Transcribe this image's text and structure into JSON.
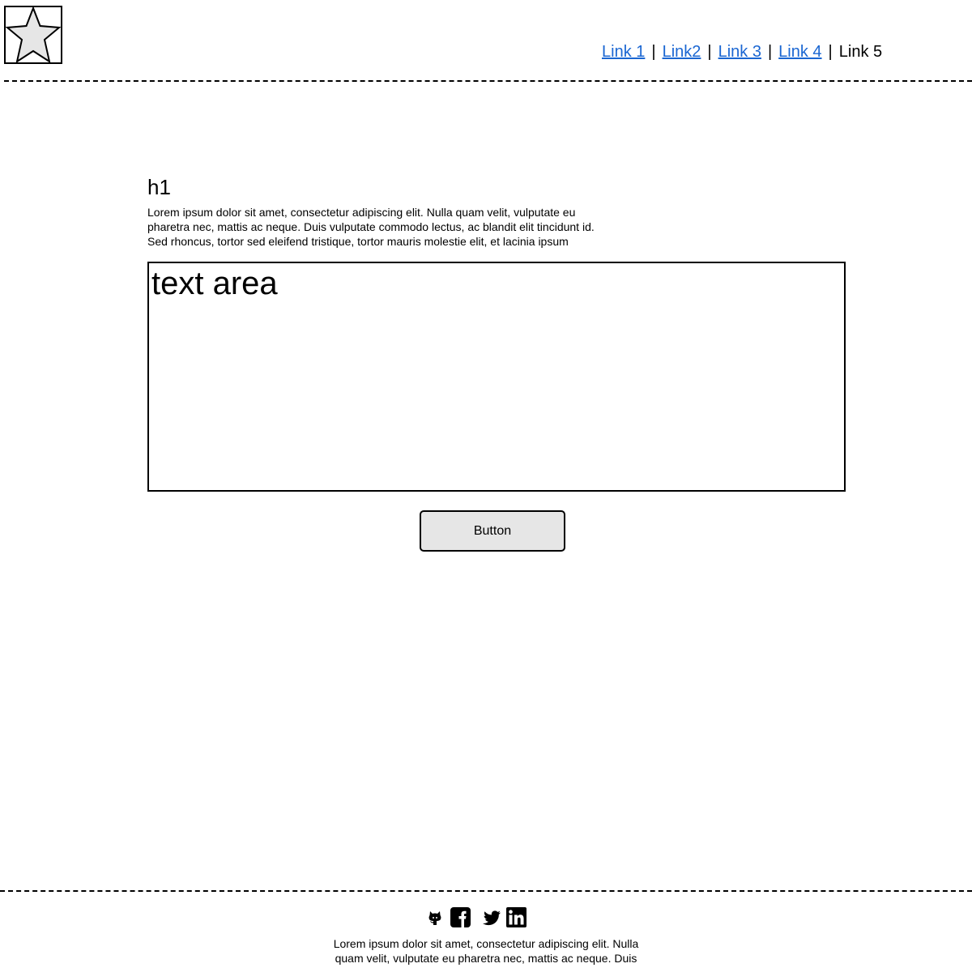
{
  "header": {
    "logo_icon": "star-icon",
    "nav": {
      "links": [
        {
          "label": "Link 1",
          "active": false
        },
        {
          "label": "Link2",
          "active": false
        },
        {
          "label": "Link 3",
          "active": false
        },
        {
          "label": "Link 4",
          "active": false
        },
        {
          "label": "Link 5",
          "active": true
        }
      ],
      "separator": "|",
      "link_color": "#1a66d2"
    }
  },
  "main": {
    "heading": "h1",
    "intro": "Lorem ipsum dolor sit amet, consectetur adipiscing elit. Nulla quam velit, vulputate eu pharetra nec, mattis ac neque. Duis vulputate commodo lectus, ac blandit elit tincidunt id. Sed rhoncus, tortor sed eleifend tristique, tortor mauris molestie elit, et lacinia ipsum",
    "textarea_value": "text area",
    "button_label": "Button",
    "button_color": "#e6e6e6"
  },
  "footer": {
    "social_icons": [
      "github-icon",
      "facebook-icon",
      "twitter-icon",
      "linkedin-icon"
    ],
    "text": "Lorem ipsum dolor sit amet, consectetur adipiscing elit. Nulla quam velit, vulputate eu pharetra nec, mattis ac neque. Duis"
  }
}
